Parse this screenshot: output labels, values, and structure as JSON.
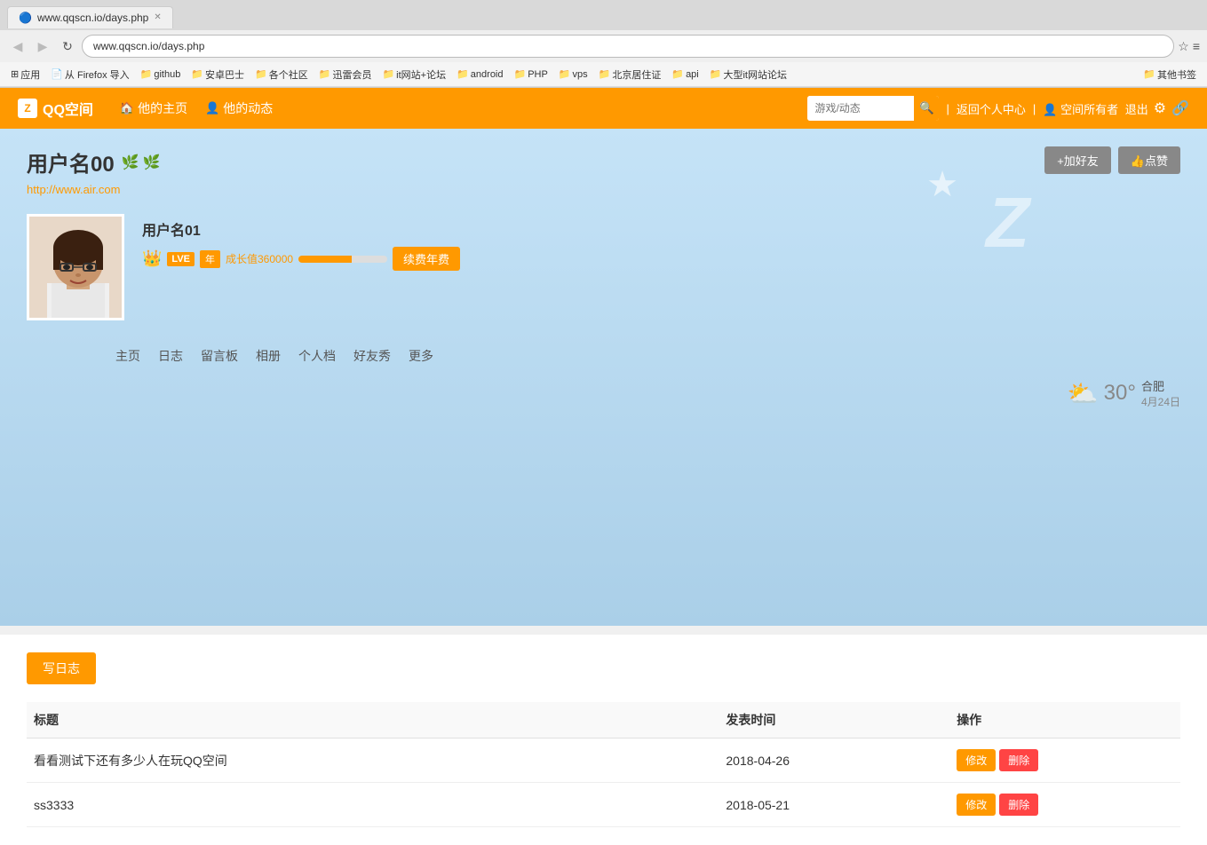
{
  "browser": {
    "tab_label": "www.qqscn.io/days.php",
    "address": "www.qqscn.io/days.php",
    "bookmarks": [
      "应用",
      "从 Firefox 导入",
      "github",
      "安卓巴士",
      "各个社区",
      "迅雷会员",
      "it网站+论坛",
      "android",
      "PHP",
      "vps",
      "北京居住证",
      "api",
      "大型it网站论坛",
      "其他书签"
    ]
  },
  "navbar": {
    "logo": "Z",
    "brand": "QQ空间",
    "nav_items": [
      {
        "label": "他的主页",
        "icon": "🏠"
      },
      {
        "label": "他的动态",
        "icon": "👤"
      }
    ],
    "search_placeholder": "游戏/动态",
    "return_link": "返回个人中心",
    "owner_label": "空间所有者",
    "logout_label": "退出"
  },
  "user": {
    "display_name": "用户名00",
    "url": "http://www.air.com",
    "profile_name": "用户名01",
    "level_badge": "LVE",
    "level_year": "年",
    "growth_label": "成长值360000",
    "renew_btn": "续费年费",
    "add_friend_btn": "+加好友",
    "like_btn": "👍点赞"
  },
  "profile_nav": {
    "items": [
      "主页",
      "日志",
      "留言板",
      "相册",
      "个人档",
      "好友秀",
      "更多"
    ]
  },
  "weather": {
    "icon": "⛅",
    "temp": "30°",
    "city": "合肥",
    "date": "4月24日"
  },
  "blog": {
    "write_btn": "写日志",
    "col_title": "标题",
    "col_date": "发表时间",
    "col_action": "操作",
    "entries": [
      {
        "title": "看看测试下还有多少人在玩QQ空间",
        "date": "2018-04-26",
        "edit_btn": "修改",
        "delete_btn": "删除"
      },
      {
        "title": "ss3333",
        "date": "2018-05-21",
        "edit_btn": "修改",
        "delete_btn": "删除"
      }
    ]
  }
}
